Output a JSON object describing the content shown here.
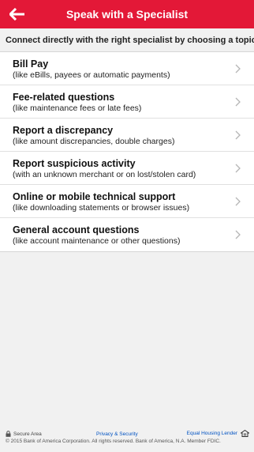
{
  "header": {
    "title": "Speak with a Specialist",
    "back_icon": "back-arrow-icon",
    "color": "#e31837"
  },
  "intro": {
    "text": "Connect directly with the right specialist by choosing a topic."
  },
  "topics": [
    {
      "title": "Bill Pay",
      "subtitle": "(like eBills, payees or automatic payments)"
    },
    {
      "title": "Fee-related questions",
      "subtitle": "(like maintenance fees or late fees)"
    },
    {
      "title": "Report a discrepancy",
      "subtitle": "(like amount discrepancies, double charges)"
    },
    {
      "title": "Report suspicious activity",
      "subtitle": "(with an unknown merchant or on lost/stolen card)"
    },
    {
      "title": "Online or mobile technical support",
      "subtitle": "(like downloading statements or browser issues)"
    },
    {
      "title": "General account questions",
      "subtitle": "(like account maintenance or other questions)"
    }
  ],
  "footer": {
    "secure_area": "Secure Area",
    "privacy_security": "Privacy & Security",
    "equal_housing": "Equal Housing Lender",
    "copyright": "© 2015 Bank of America Corporation. All rights reserved. Bank of America, N.A. Member FDIC.",
    "link_color": "#0052c2"
  }
}
